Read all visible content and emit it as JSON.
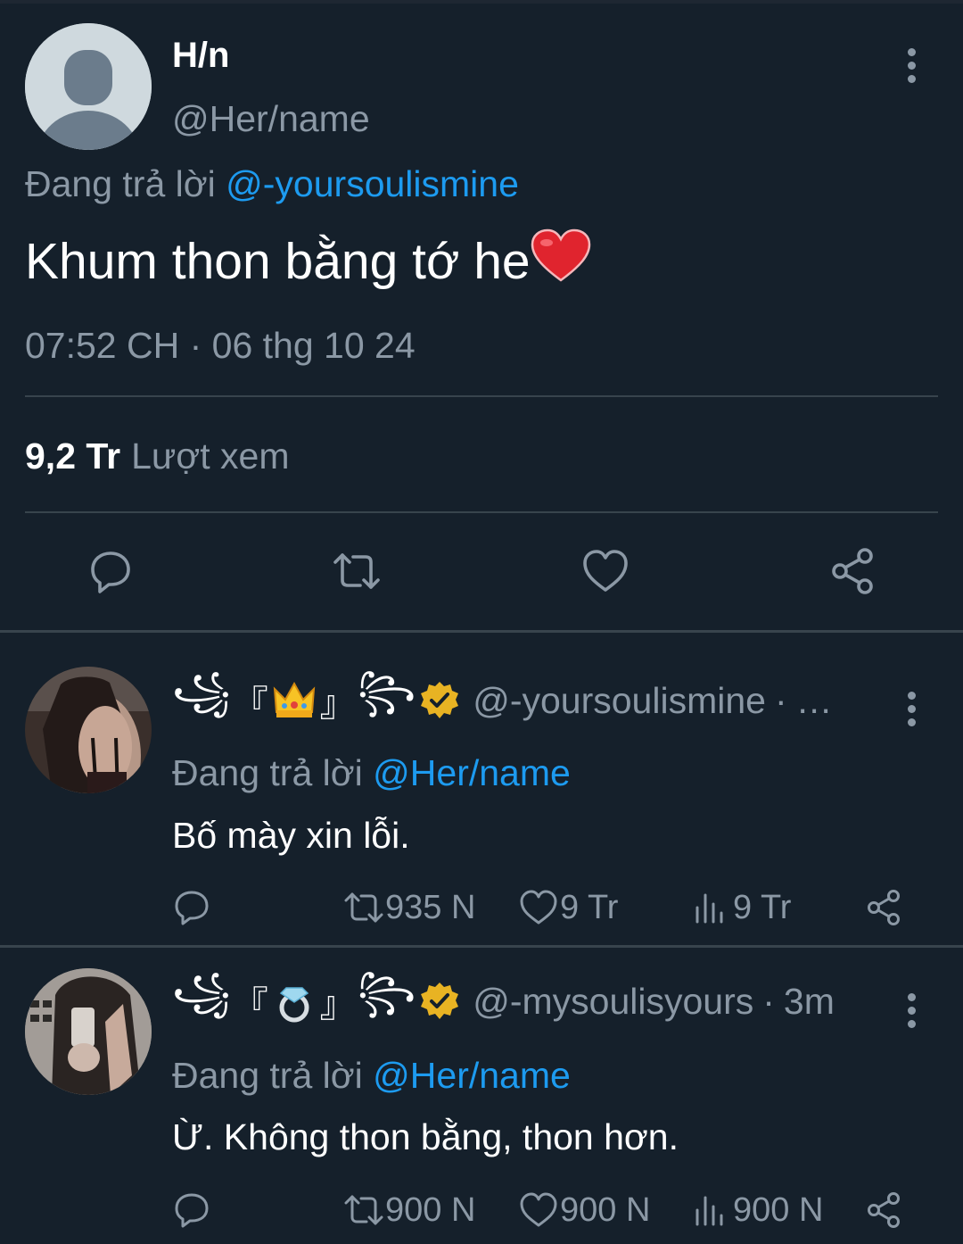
{
  "main_tweet": {
    "display_name": "H/n",
    "handle": "@Her/name",
    "replying_prefix": "Đang trả lời",
    "replying_to": "@-yoursoulismine",
    "text": "Khum thon bằng tớ he",
    "text_emoji": "heart-red-emoji",
    "timestamp": "07:52 CH · 06 thg 10 24",
    "views_count": "9,2 Tr",
    "views_label": "Lượt xem",
    "actions": [
      "reply-icon",
      "retweet-icon",
      "like-icon",
      "share-icon"
    ]
  },
  "replies": [
    {
      "name_deco_left": "꧁",
      "bracket_open": "『",
      "badge_emoji": "crown-emoji",
      "bracket_close": "』",
      "name_deco_right": "꧂",
      "handle": "@-yoursoulismine",
      "time": "…",
      "replying_prefix": "Đang trả lời",
      "replying_to": "@Her/name",
      "text": "Bố mày xin lỗi.",
      "retweets": "935 N",
      "likes": "9 Tr",
      "views": "9 Tr"
    },
    {
      "name_deco_left": "꧁",
      "bracket_open": "『",
      "badge_emoji": "ring-emoji",
      "bracket_close": "』",
      "name_deco_right": "꧂",
      "handle": "@-mysoulisyours",
      "time": "3m",
      "replying_prefix": "Đang trả lời",
      "replying_to": "@Her/name",
      "text": "Ừ. Không thon bằng, thon hơn.",
      "retweets": "900 N",
      "likes": "900 N",
      "views": "900 N"
    }
  ],
  "colors": {
    "background": "#15202b",
    "secondary_text": "#8b98a5",
    "accent_link": "#1d9bf0",
    "divider": "#38444d",
    "verified_gold": "#e8b323"
  }
}
